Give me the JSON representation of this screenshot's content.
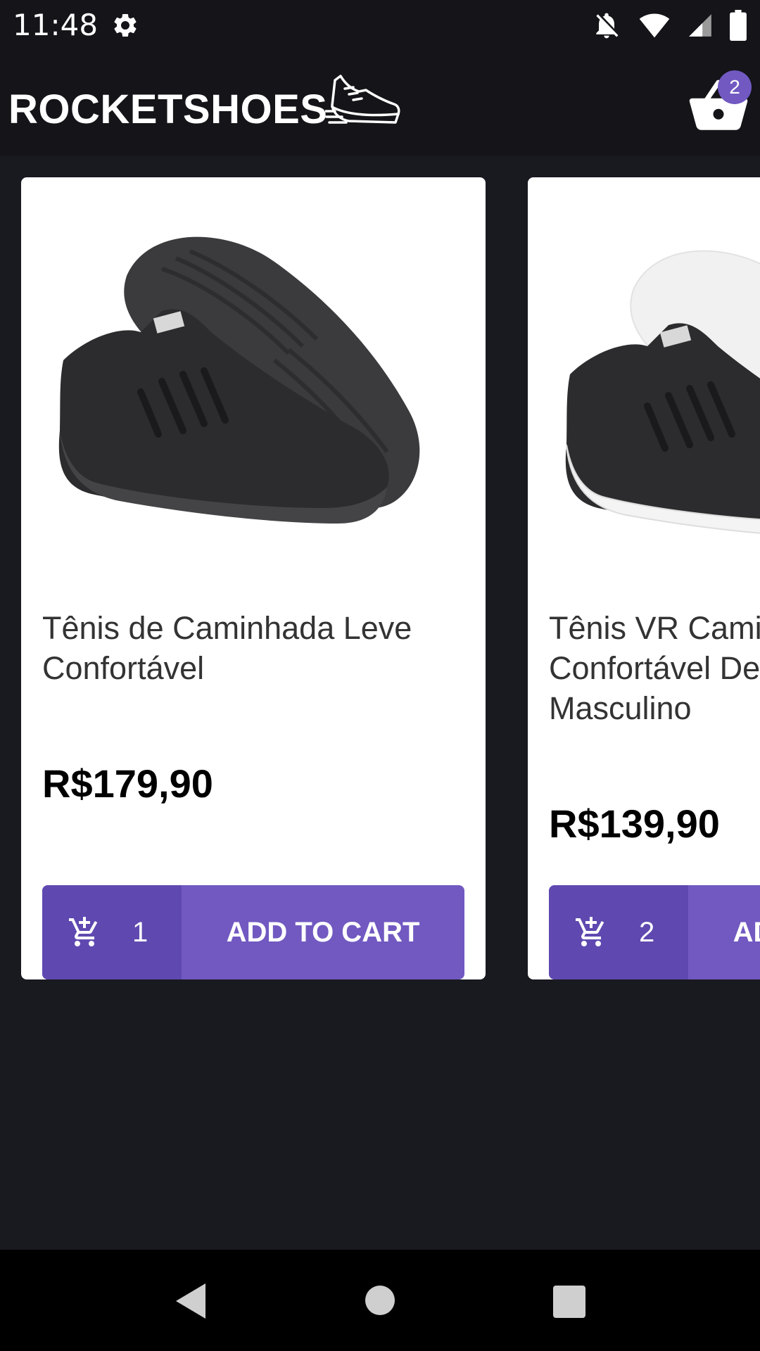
{
  "status_bar": {
    "time": "11:48",
    "icons": [
      "settings-icon",
      "notifications-off-icon",
      "wifi-icon",
      "signal-icon",
      "battery-icon"
    ]
  },
  "header": {
    "brand": "ROCKETSHOES",
    "logo_icon": "running-shoe-icon",
    "cart_icon": "basket-icon",
    "cart_count": "2"
  },
  "products": [
    {
      "title": "Tênis de Caminhada Leve Confortável",
      "price": "R$179,90",
      "amount": "1",
      "button_label": "ADD TO CART",
      "image": "black-sneaker-black-sole"
    },
    {
      "title": "Tênis VR Caminhada Confortável Detalhes Couro Masculino",
      "price": "R$139,90",
      "amount": "2",
      "button_label": "ADD TO CART",
      "image": "black-sneaker-white-sole"
    }
  ],
  "nav_bar": {
    "icons": [
      "back-icon",
      "home-icon",
      "recents-icon"
    ]
  },
  "colors": {
    "background": "#191920",
    "header": "#141419",
    "accent": "#7159c1",
    "accent_dark": "#5f49b0",
    "card": "#ffffff"
  }
}
